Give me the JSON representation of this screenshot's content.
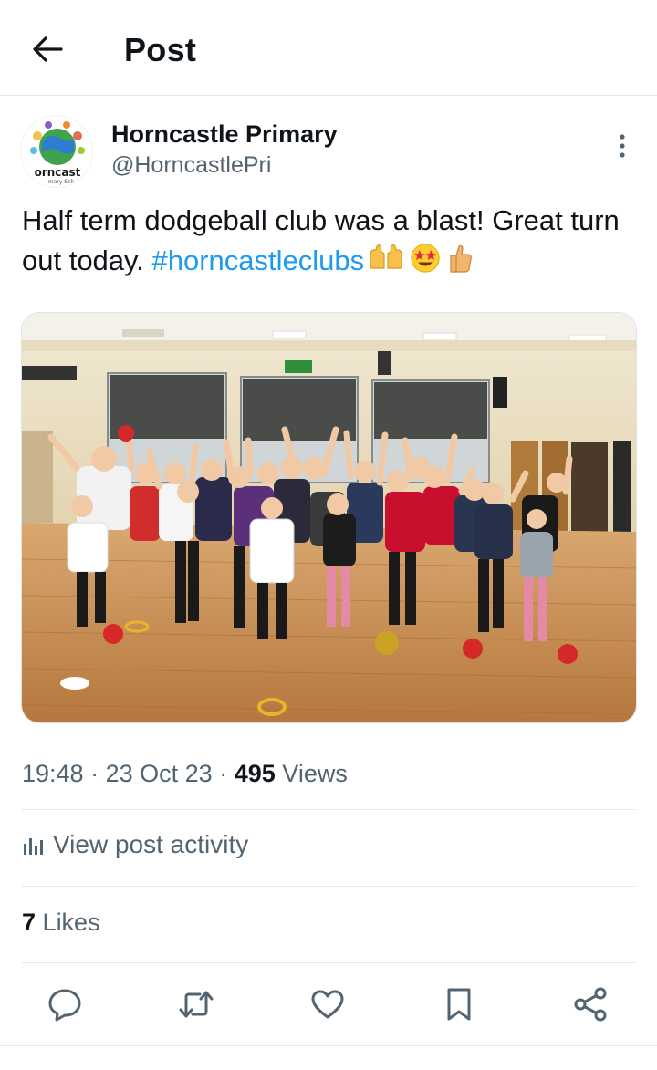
{
  "header": {
    "title": "Post",
    "back_icon": "arrow-left-icon"
  },
  "post": {
    "author": {
      "name": "Horncastle Primary",
      "handle": "@HorncastlePri",
      "avatar_text": "orncast",
      "avatar_subtext": "mary Sch"
    },
    "text_before": "Half term dodgeball club was a blast! Great turn out today. ",
    "hashtag": "#horncastleclubs",
    "emojis": [
      "raising-hands-emoji",
      "star-struck-emoji",
      "thumbs-up-emoji"
    ],
    "image": {
      "description_icon": "photo"
    },
    "time": "19:48",
    "date": "23 Oct 23",
    "views_count": "495",
    "views_label": "Views",
    "sep": "·"
  },
  "activity": {
    "label": "View post activity",
    "icon": "bar-chart-icon"
  },
  "likes": {
    "count": "7",
    "label": "Likes"
  },
  "actions": [
    "reply-icon",
    "repost-icon",
    "like-icon",
    "bookmark-icon",
    "share-icon"
  ],
  "colors": {
    "link": "#1d9bf0",
    "secondary": "#536471",
    "primary": "#0f1419"
  }
}
